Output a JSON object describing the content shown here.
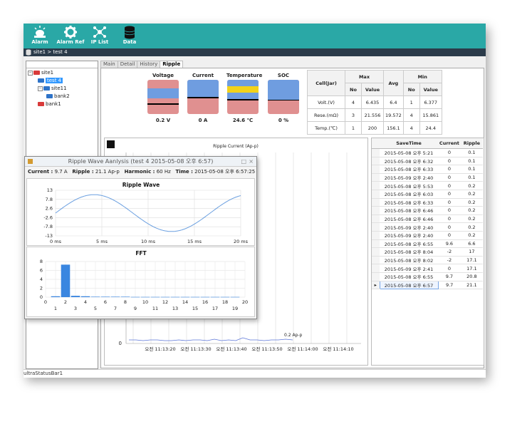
{
  "toolbar": {
    "buttons": [
      {
        "label": "Alarm",
        "icon": "alarm-icon"
      },
      {
        "label": "Alarm Ref",
        "icon": "gear-icon"
      },
      {
        "label": "IP List",
        "icon": "network-icon"
      },
      {
        "label": "Data",
        "icon": "database-icon"
      }
    ]
  },
  "breadcrumb": "site1 > test 4",
  "tree": {
    "items": [
      {
        "label": "site1",
        "level": 0,
        "expander": "−"
      },
      {
        "label": "test 4",
        "level": 1,
        "selected": true
      },
      {
        "label": "site11",
        "level": 1,
        "expander": "−"
      },
      {
        "label": "bank2",
        "level": 2
      },
      {
        "label": "bank1",
        "level": 1
      }
    ]
  },
  "tabs": [
    "Main",
    "Detail",
    "History",
    "Ripple"
  ],
  "active_tab": "Ripple",
  "gauges": [
    {
      "title": "Voltage",
      "value": "0.2 V"
    },
    {
      "title": "Current",
      "value": "0 A"
    },
    {
      "title": "Temperature",
      "value": "24.6 ℃"
    },
    {
      "title": "SOC",
      "value": "0 %"
    }
  ],
  "minmax": {
    "headers": {
      "cell": "Cell(Jar)",
      "max": "Max",
      "avg": "Avg",
      "min": "Min",
      "no": "No",
      "value": "Value"
    },
    "rows": [
      {
        "label": "Volt.(V)",
        "max_no": "4",
        "max_value": "6.435",
        "avg": "6.4",
        "min_no": "1",
        "min_value": "6.377"
      },
      {
        "label": "Rese.(mΩ)",
        "max_no": "3",
        "max_value": "21.556",
        "avg": "19.572",
        "min_no": "4",
        "min_value": "15.861"
      },
      {
        "label": "Temp.(℃)",
        "max_no": "1",
        "max_value": "200",
        "avg": "156.1",
        "min_no": "4",
        "min_value": "24.4"
      }
    ]
  },
  "ripple_chart": {
    "title": "Ripple Current (Ap-p)",
    "annotation": "0.2 Ap-p",
    "y_tick": "0",
    "x_ticks": [
      "오전 11:13:20",
      "오전 11:13:30",
      "오전 11:13:40",
      "오전 11:13:50",
      "오전 11:14:00",
      "오전 11:14:10"
    ]
  },
  "grid": {
    "headers": [
      "SaveTime",
      "Current",
      "Ripple"
    ],
    "rows": [
      [
        "2015-05-08 오후 5:21",
        "0",
        "0.1"
      ],
      [
        "2015-05-08 오후 6:32",
        "0",
        "0.1"
      ],
      [
        "2015-05-08 오후 6:33",
        "0",
        "0.1"
      ],
      [
        "2015-05-09 오후 2:40",
        "0",
        "0.1"
      ],
      [
        "2015-05-08 오후 5:53",
        "0",
        "0.2"
      ],
      [
        "2015-05-08 오후 6:03",
        "0",
        "0.2"
      ],
      [
        "2015-05-08 오후 6:33",
        "0",
        "0.2"
      ],
      [
        "2015-05-08 오후 6:46",
        "0",
        "0.2"
      ],
      [
        "2015-05-08 오후 6:46",
        "0",
        "0.2"
      ],
      [
        "2015-05-09 오후 2:40",
        "0",
        "0.2"
      ],
      [
        "2015-05-09 오후 2:40",
        "0",
        "0.2"
      ],
      [
        "2015-05-08 오후 6:55",
        "9.6",
        "6.6"
      ],
      [
        "2015-05-08 오후 8:04",
        "-2",
        "17"
      ],
      [
        "2015-05-08 오후 8:02",
        "-2",
        "17.1"
      ],
      [
        "2015-05-09 오후 2:41",
        "0",
        "17.1"
      ],
      [
        "2015-05-08 오후 6:55",
        "9.7",
        "20.8"
      ],
      [
        "2015-05-08 오후 6:57",
        "9.7",
        "21.1"
      ]
    ],
    "selected_row": 16
  },
  "status_bar": "ultraStatusBar1",
  "popup": {
    "title": "Ripple Wave Aanlysis (test 4 2015-05-08 오후 6:57)",
    "info": {
      "current_label": "Current :",
      "current_value": "9.7 A",
      "ripple_label": "Ripple :",
      "ripple_value": "21.1 Ap-p",
      "harmonic_label": "Harmonic :",
      "harmonic_value": "60 Hz",
      "time_label": "Time :",
      "time_value": "2015-05-08 오후 6:57:25"
    },
    "wave": {
      "title": "Ripple Wave",
      "y_ticks": [
        "13",
        "7.8",
        "2.6",
        "-2.6",
        "-7.8",
        "-13"
      ],
      "x_ticks": [
        "0 ms",
        "5 ms",
        "10 ms",
        "15 ms",
        "20 ms"
      ]
    },
    "fft": {
      "title": "FFT",
      "y_ticks": [
        "8",
        "6",
        "4",
        "2",
        "0"
      ],
      "x_ticks_top": [
        "0",
        "2",
        "4",
        "6",
        "8",
        "10",
        "12",
        "14",
        "16",
        "18",
        "20"
      ],
      "x_ticks_bottom": [
        "1",
        "3",
        "5",
        "7",
        "9",
        "11",
        "13",
        "15",
        "17",
        "19"
      ]
    }
  },
  "chart_data": [
    {
      "type": "line",
      "title": "Ripple Wave",
      "xlabel": "",
      "ylabel": "",
      "xlim": [
        0,
        20
      ],
      "ylim": [
        -13,
        13
      ],
      "series": [
        {
          "amplitude": 10.5,
          "period_ms": 16.7,
          "phase_deg": 0
        }
      ],
      "color": "#6a9fe0"
    },
    {
      "type": "bar",
      "title": "FFT",
      "ylim": [
        0,
        8
      ],
      "categories": [
        1,
        2,
        3,
        4,
        5,
        6,
        7,
        8,
        9,
        10,
        11,
        12,
        13,
        14,
        15,
        16,
        17,
        18,
        19
      ],
      "values": [
        0.2,
        7.3,
        0.3,
        0.2,
        0.1,
        0.1,
        0.1,
        0.1,
        0.05,
        0.05,
        0.05,
        0.05,
        0.05,
        0.05,
        0.05,
        0.05,
        0.05,
        0.05,
        0.05
      ],
      "color": "#3a86e0"
    }
  ],
  "colors": {
    "toolbar": "#2aa8a6",
    "gauge_red": "#e09090",
    "gauge_blue": "#6f9de0",
    "gauge_yellow": "#f2d21a"
  }
}
